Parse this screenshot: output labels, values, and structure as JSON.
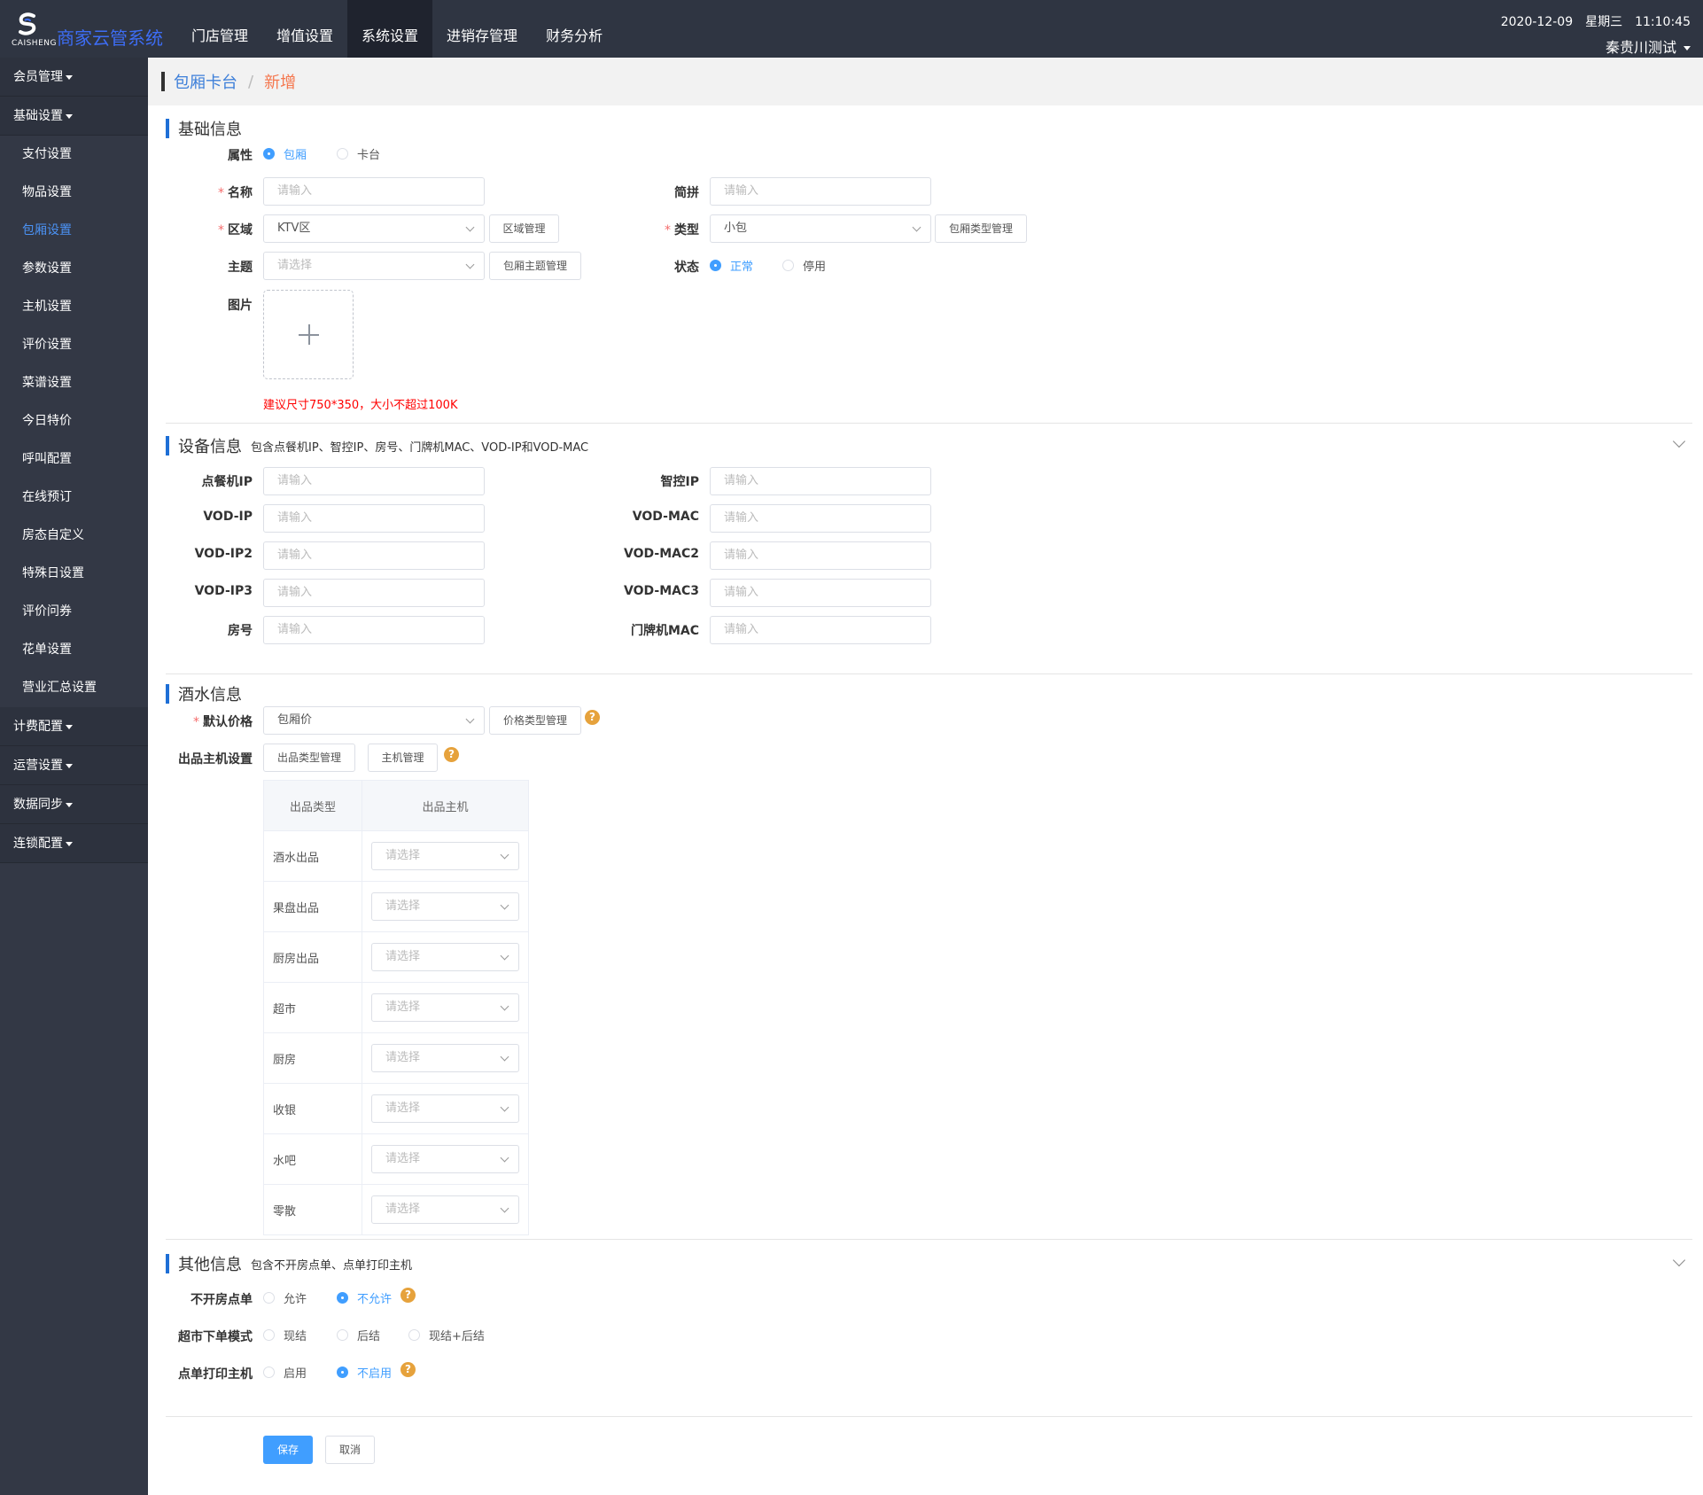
{
  "header": {
    "logo_sub": "CAISHENG",
    "app_title": "商家云管系统",
    "nav": [
      "门店管理",
      "增值设置",
      "系统设置",
      "进销存管理",
      "财务分析"
    ],
    "nav_active": 2,
    "date": "2020-12-09",
    "weekday": "星期三",
    "time": "11:10:45",
    "user": "秦贵川测试"
  },
  "sidebar": {
    "group_member": "会员管理",
    "group_basic": "基础设置",
    "items": [
      "支付设置",
      "物品设置",
      "包厢设置",
      "参数设置",
      "主机设置",
      "评价设置",
      "菜谱设置",
      "今日特价",
      "呼叫配置",
      "在线预订",
      "房态自定义",
      "特殊日设置",
      "评价问券",
      "花单设置",
      "营业汇总设置"
    ],
    "active_index": 2,
    "group_billing": "计费配置",
    "group_ops": "运营设置",
    "group_sync": "数据同步",
    "group_chain": "连锁配置"
  },
  "breadcrumb": {
    "parent": "包厢卡台",
    "sep": "/",
    "current": "新增"
  },
  "basic": {
    "title": "基础信息",
    "attr_label": "属性",
    "attr_opt1": "包厢",
    "attr_opt2": "卡台",
    "name_label": "名称",
    "name_placeholder": "请输入",
    "pinyin_label": "简拼",
    "pinyin_placeholder": "请输入",
    "area_label": "区域",
    "area_value": "KTV区",
    "area_btn": "区域管理",
    "type_label": "类型",
    "type_value": "小包",
    "type_btn": "包厢类型管理",
    "theme_label": "主题",
    "theme_placeholder": "请选择",
    "theme_btn": "包厢主题管理",
    "status_label": "状态",
    "status_opt1": "正常",
    "status_opt2": "停用",
    "image_label": "图片",
    "image_tip": "建议尺寸750*350，大小不超过100K"
  },
  "device": {
    "title": "设备信息",
    "subtitle": "包含点餐机IP、智控IP、房号、门牌机MAC、VOD-IP和VOD-MAC",
    "placeholder": "请输入",
    "left": [
      "点餐机IP",
      "VOD-IP",
      "VOD-IP2",
      "VOD-IP3",
      "房号"
    ],
    "right": [
      "智控IP",
      "VOD-MAC",
      "VOD-MAC2",
      "VOD-MAC3",
      "门牌机MAC"
    ]
  },
  "drinks": {
    "title": "酒水信息",
    "price_label": "默认价格",
    "price_value": "包厢价",
    "price_btn": "价格类型管理",
    "host_label": "出品主机设置",
    "host_btn1": "出品类型管理",
    "host_btn2": "主机管理",
    "table_head1": "出品类型",
    "table_head2": "出品主机",
    "select_placeholder": "请选择",
    "rows": [
      "酒水出品",
      "果盘出品",
      "厨房出品",
      "超市",
      "厨房",
      "收银",
      "水吧",
      "零散"
    ]
  },
  "other": {
    "title": "其他信息",
    "subtitle": "包含不开房点单、点单打印主机",
    "row1_label": "不开房点单",
    "row1_opt1": "允许",
    "row1_opt2": "不允许",
    "row2_label": "超市下单模式",
    "row2_opt1": "现结",
    "row2_opt2": "后结",
    "row2_opt3": "现结+后结",
    "row3_label": "点单打印主机",
    "row3_opt1": "启用",
    "row3_opt2": "不启用"
  },
  "actions": {
    "save": "保存",
    "cancel": "取消"
  },
  "colors": {
    "primary": "#409eff",
    "topbar": "#2f3542",
    "sidebar": "#333845",
    "required": "#f56c6c",
    "help": "#e6a23c"
  }
}
